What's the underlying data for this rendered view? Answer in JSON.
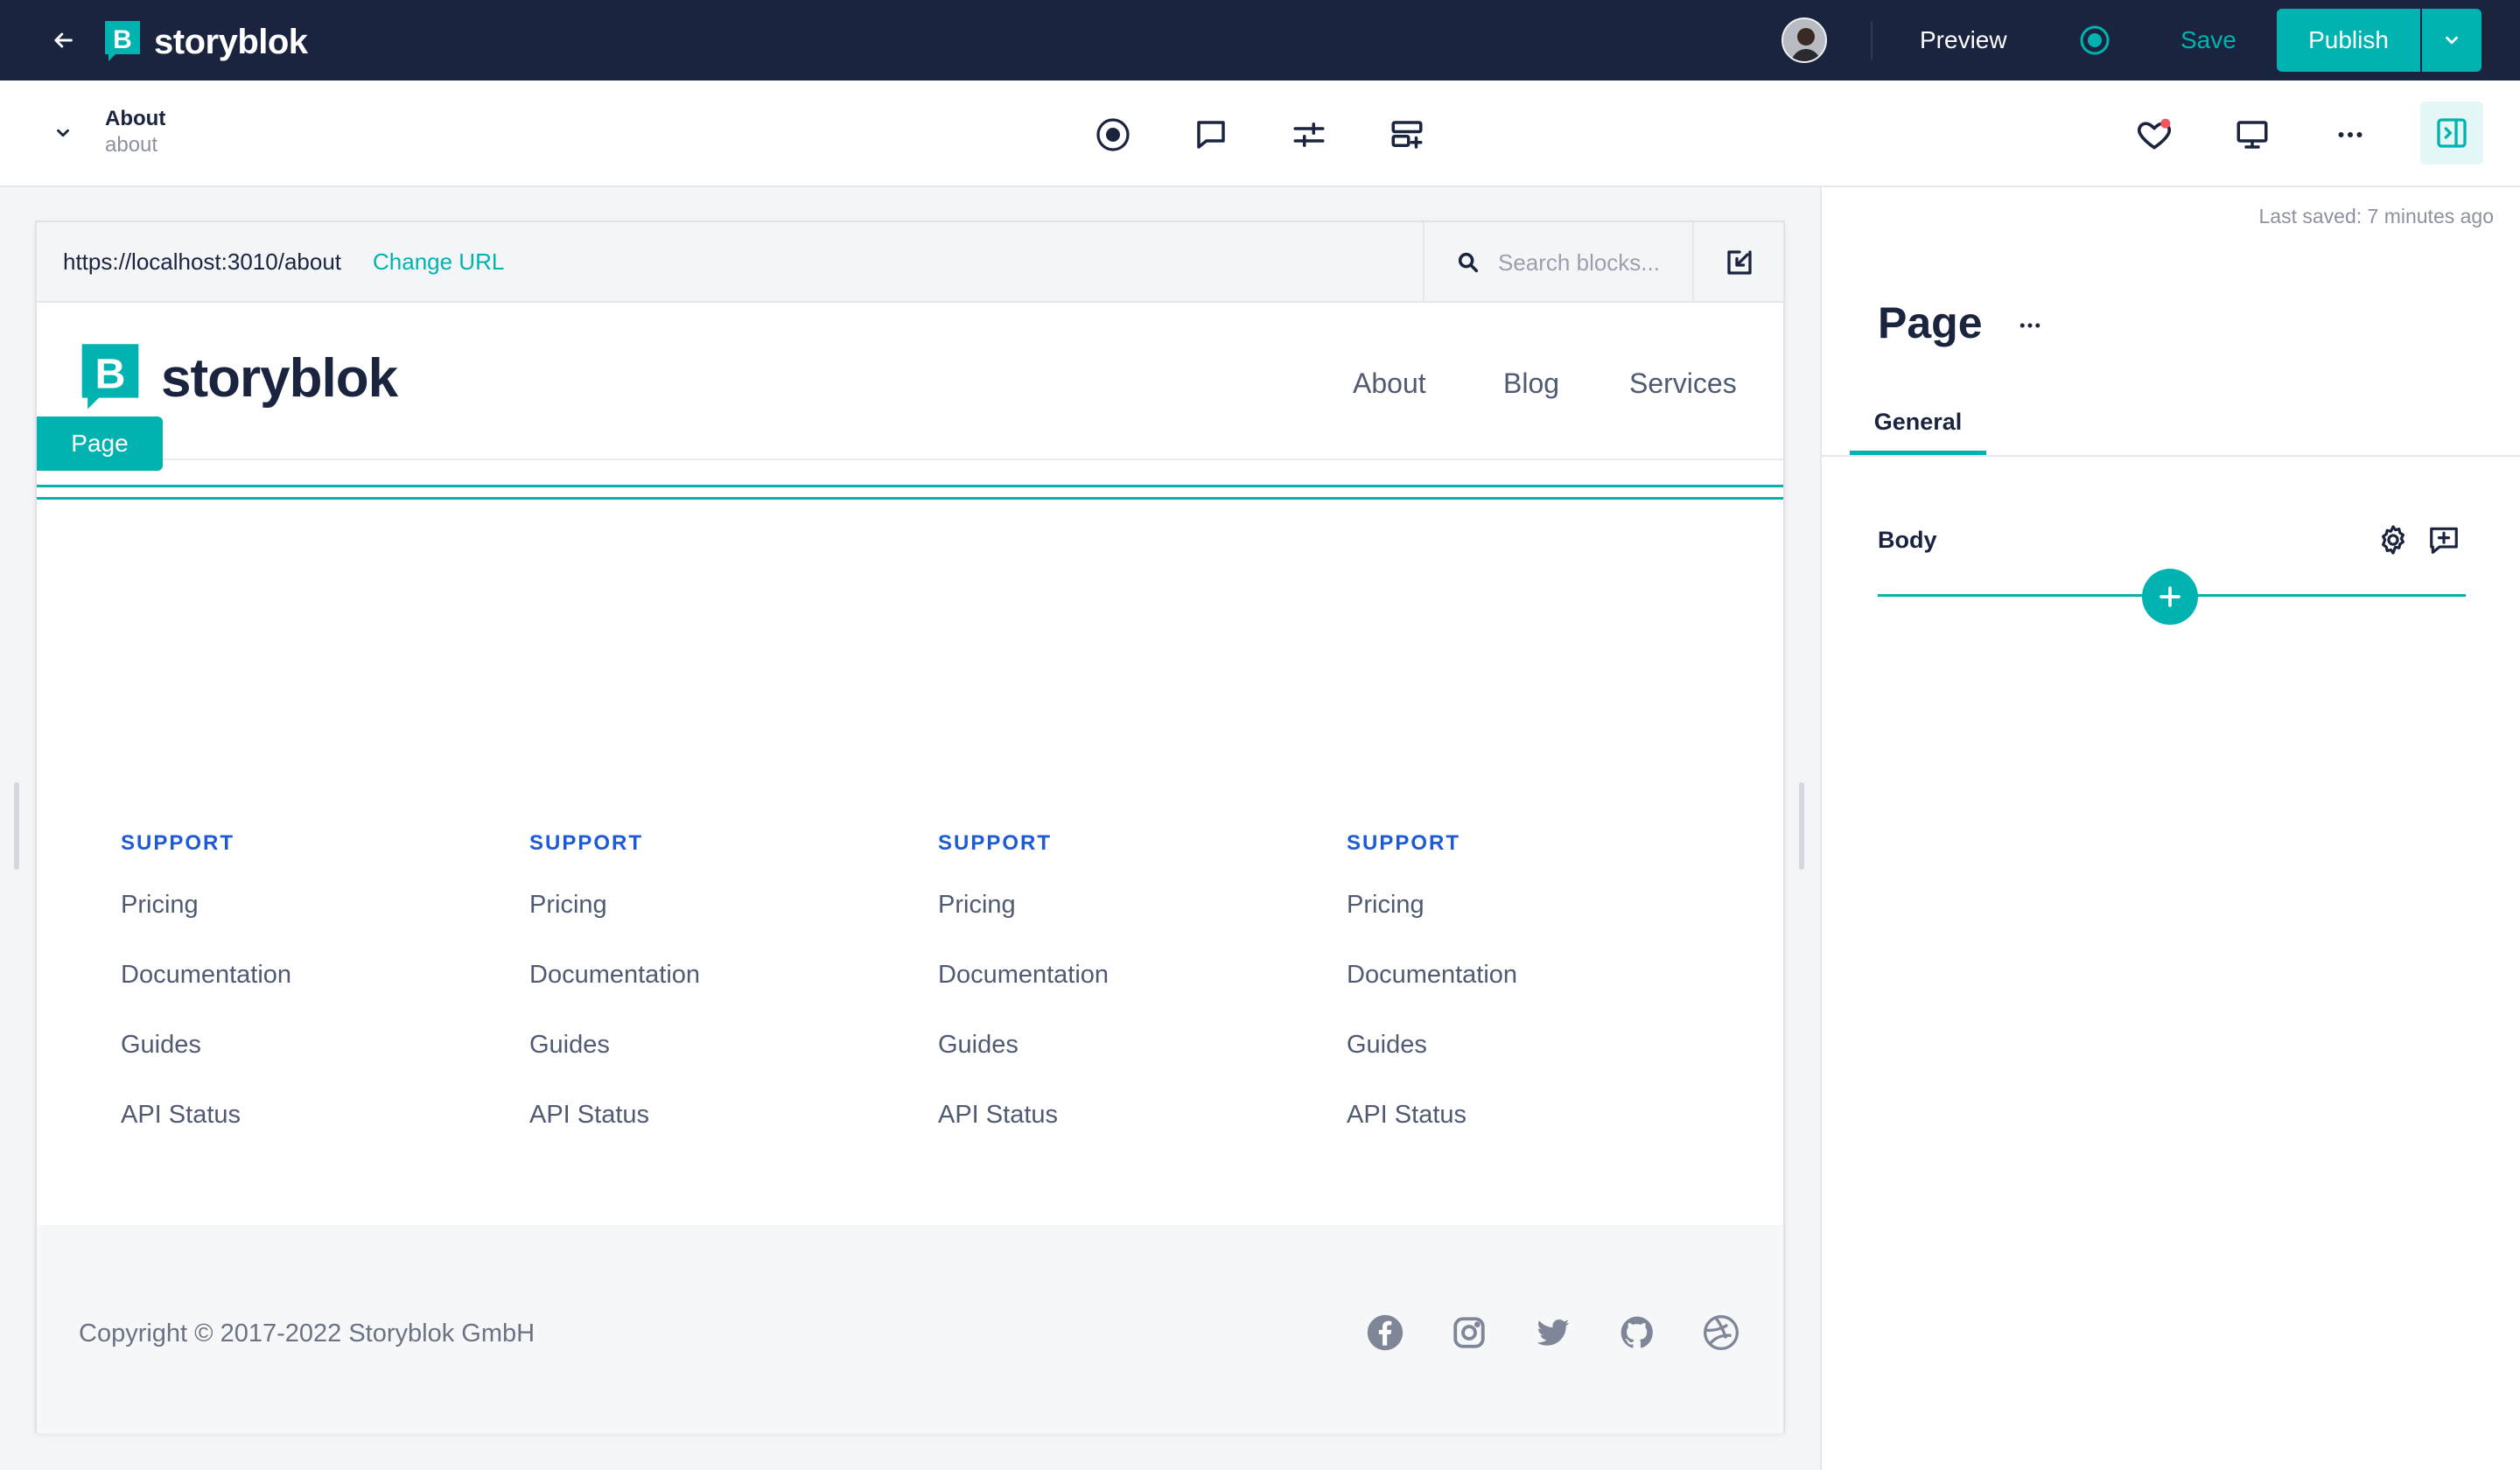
{
  "app": {
    "brand": "storyblok",
    "accent_color": "#00b3b0",
    "topbar_color": "#1b243f"
  },
  "topbar": {
    "preview_label": "Preview",
    "save_label": "Save",
    "publish_label": "Publish"
  },
  "story": {
    "title": "About",
    "slug": "about"
  },
  "preview": {
    "url": "https://localhost:3010/about",
    "change_url_label": "Change URL",
    "search_placeholder": "Search blocks...",
    "site": {
      "brand": "storyblok",
      "nav": [
        "About",
        "Blog",
        "Services"
      ],
      "page_tag": "Page",
      "footer_columns": [
        {
          "heading": "SUPPORT",
          "links": [
            "Pricing",
            "Documentation",
            "Guides",
            "API Status"
          ]
        },
        {
          "heading": "SUPPORT",
          "links": [
            "Pricing",
            "Documentation",
            "Guides",
            "API Status"
          ]
        },
        {
          "heading": "SUPPORT",
          "links": [
            "Pricing",
            "Documentation",
            "Guides",
            "API Status"
          ]
        },
        {
          "heading": "SUPPORT",
          "links": [
            "Pricing",
            "Documentation",
            "Guides",
            "API Status"
          ]
        }
      ],
      "copyright": "Copyright © 2017-2022  Storyblok GmbH",
      "social_icons": [
        "facebook-icon",
        "instagram-icon",
        "twitter-icon",
        "github-icon",
        "dribbble-icon"
      ]
    }
  },
  "panel": {
    "last_saved": "Last saved: 7 minutes ago",
    "title": "Page",
    "tab": "General",
    "field_label": "Body"
  }
}
